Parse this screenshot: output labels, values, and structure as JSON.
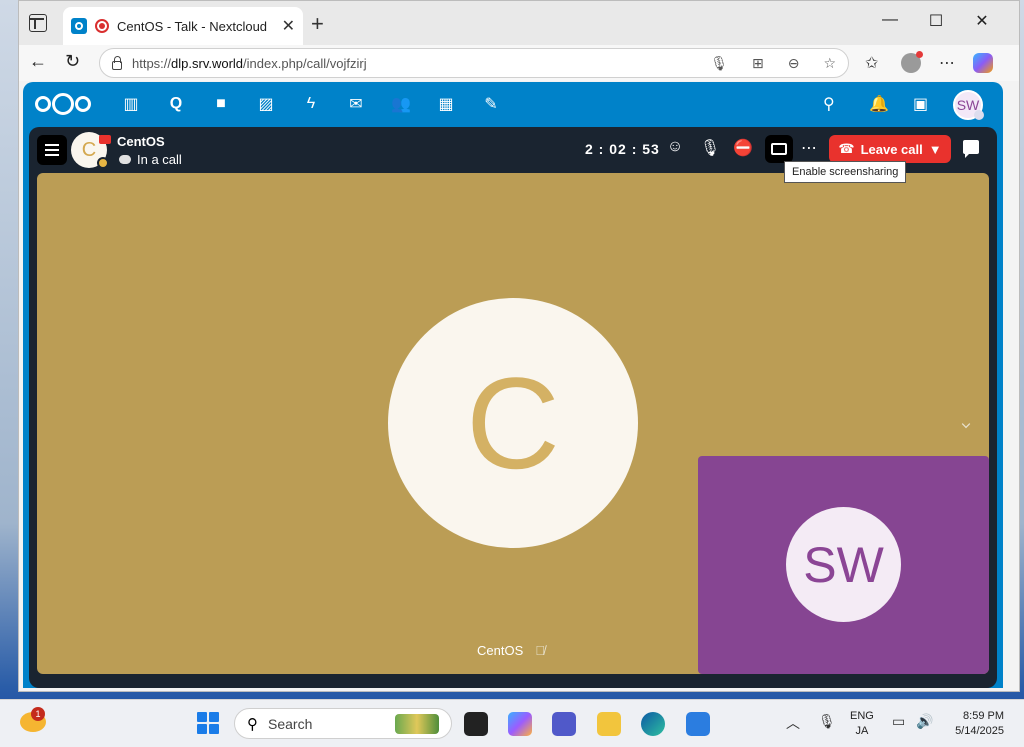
{
  "browser": {
    "tab_title": "CentOS - Talk - Nextcloud",
    "url_prefix": "https://",
    "url_host": "dlp.srv.world",
    "url_path": "/index.php/call/vojfzirj"
  },
  "nextcloud": {
    "user_initials": "SW"
  },
  "call": {
    "conversation_name": "CentOS",
    "conversation_initial": "C",
    "status": "In a call",
    "timer": "2 : 02 : 53",
    "leave_label": "Leave call",
    "tooltip": "Enable screensharing",
    "main_participant_initial": "C",
    "main_participant_name": "CentOS",
    "self_initials": "SW"
  },
  "taskbar": {
    "notification_count": "1",
    "search_placeholder": "Search",
    "lang_line1": "ENG",
    "lang_line2": "JA",
    "time": "8:59 PM",
    "date": "5/14/2025"
  },
  "colors": {
    "nextcloud_blue": "#0082c9",
    "leave_red": "#e9322d",
    "main_tile": "#bb9d55",
    "self_tile": "#864592"
  }
}
